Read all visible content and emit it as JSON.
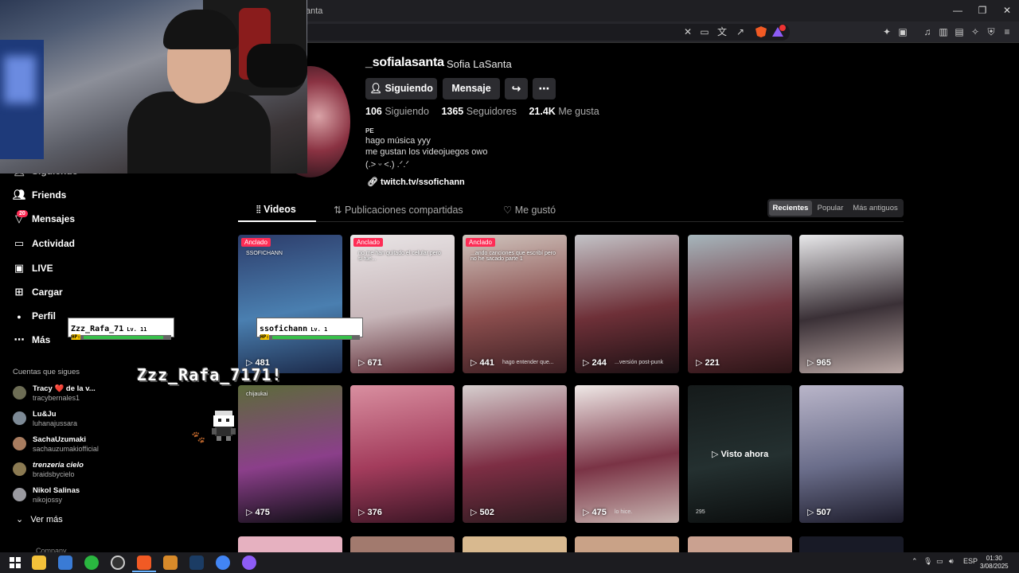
{
  "browser": {
    "address_text": "anta",
    "window_min": "—",
    "window_restore": "❐",
    "window_close": "✕"
  },
  "profile": {
    "username": "_sofialasanta",
    "nickname": "Sofia LaSanta",
    "follow_label": "Siguiendo",
    "message_label": "Mensaje",
    "stats": [
      {
        "value": "106",
        "label": "Siguiendo"
      },
      {
        "value": "1365",
        "label": "Seguidores"
      },
      {
        "value": "21.4K",
        "label": "Me gusta"
      }
    ],
    "bio_line1": "PE",
    "bio_line2": "hago música yyy",
    "bio_line3": "me gustan los videojuegos owo",
    "bio_line4": "(.> ᵕ <.) .ᐟ.ᐟ",
    "link": "twitch.tv/ssofichann"
  },
  "tabs": [
    {
      "label": "Videos"
    },
    {
      "label": "Publicaciones compartidas"
    },
    {
      "label": "Me gustó"
    }
  ],
  "sort": [
    "Recientes",
    "Popular",
    "Más antiguos"
  ],
  "sidebar": {
    "items": [
      {
        "label": "Siguiendo"
      },
      {
        "label": "Friends"
      },
      {
        "label": "Mensajes"
      },
      {
        "label": "Actividad"
      },
      {
        "label": "LIVE"
      },
      {
        "label": "Cargar"
      },
      {
        "label": "Perfil"
      },
      {
        "label": "Más"
      }
    ],
    "messages_badge": "20",
    "following_title": "Cuentas que sigues",
    "accounts": [
      {
        "name": "Tracy ❤️ de la v...",
        "handle": "tracybernales1"
      },
      {
        "name": "Lu&Ju",
        "handle": "luhanajussara"
      },
      {
        "name": "SachaUzumaki",
        "handle": "sachauzumakiofficial"
      },
      {
        "name": "trenzeria cielo",
        "handle": "braidsbycielo"
      },
      {
        "name": "Nikol Salinas",
        "handle": "nikojossy"
      }
    ],
    "see_more": "Ver más",
    "company": "Company"
  },
  "overlay": {
    "player1_name": "Zzz_Rafa_71",
    "player1_lv": "Lv. 11",
    "player2_name": "ssofichann",
    "player2_lv": "Lv. 1",
    "hp_label": "HP:",
    "big_name": "Zzz_Rafa_7171!",
    "player1_hp": 1.0,
    "player2_hp": 1.0
  },
  "videos": [
    {
      "views": "481",
      "pinned": "Anclado",
      "colors": [
        "#2d3d6b",
        "#4a7fb0",
        "#1c2a4a"
      ],
      "caption": "SSOFICHANN"
    },
    {
      "views": "671",
      "pinned": "Anclado",
      "colors": [
        "#e9e5e6",
        "#c7b6b9",
        "#5a2630"
      ],
      "caption": "no me han quitado el celular pero si fue..."
    },
    {
      "views": "441",
      "pinned": "Anclado",
      "colors": [
        "#cfc4bd",
        "#8a4d4d",
        "#3b1e22"
      ],
      "caption": "...ando canciones que escribí pero no he sacado parte 1",
      "sub": "hago entender que..."
    },
    {
      "views": "244",
      "pinned": "",
      "colors": [
        "#c3c3c7",
        "#6e3038",
        "#1b1013"
      ],
      "caption": "",
      "sub": "...versión post-punk"
    },
    {
      "views": "221",
      "pinned": "",
      "colors": [
        "#a6b6bc",
        "#723640",
        "#2b1416"
      ],
      "caption": ""
    },
    {
      "views": "965",
      "pinned": "",
      "colors": [
        "#e8e8ea",
        "#3a3036",
        "#b9a7a4"
      ],
      "caption": ""
    },
    {
      "views": "475",
      "pinned": "",
      "colors": [
        "#5c6b3a",
        "#8b3f8a",
        "#0d0d12"
      ],
      "caption": "chijaukai"
    },
    {
      "views": "376",
      "pinned": "",
      "colors": [
        "#d98fa0",
        "#a33c5c",
        "#3a1524"
      ],
      "caption": ""
    },
    {
      "views": "502",
      "pinned": "",
      "colors": [
        "#d6cfcf",
        "#7d2e44",
        "#2c1a1f"
      ],
      "caption": ""
    },
    {
      "views": "475",
      "pinned": "",
      "colors": [
        "#efe9e7",
        "#7a3345",
        "#c8b5b1"
      ],
      "caption": "",
      "sub": "lo hice."
    },
    {
      "views": "",
      "pinned": "",
      "colors": [
        "#151a1a",
        "#243030",
        "#0a0c0c"
      ],
      "caption": "",
      "visto": "Visto ahora",
      "sub": "295"
    },
    {
      "views": "507",
      "pinned": "",
      "colors": [
        "#b9b5c9",
        "#6a6d8a",
        "#1c1b2a"
      ],
      "caption": ""
    }
  ],
  "taskbar": {
    "lang": "ESP",
    "time": "01:30",
    "date": "3/08/2025"
  }
}
